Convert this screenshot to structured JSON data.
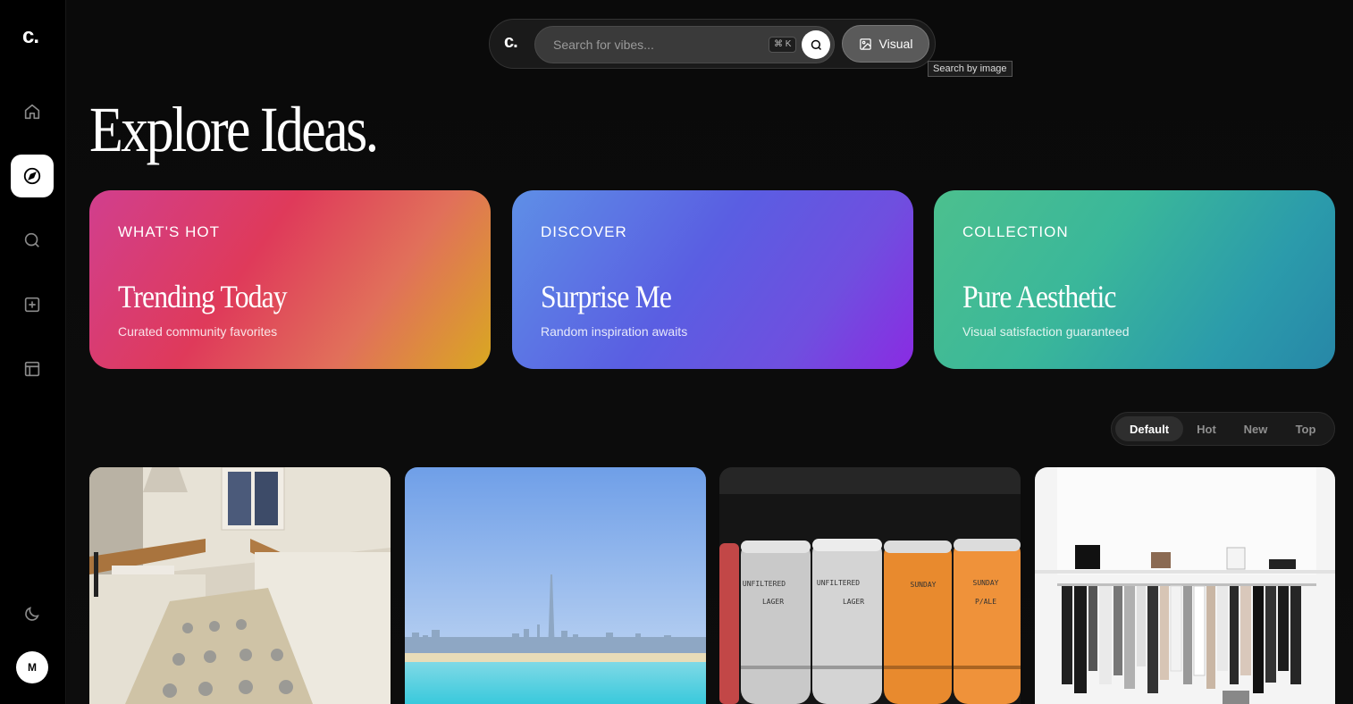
{
  "app": {
    "logo": "c."
  },
  "sidebar": {
    "items": [
      {
        "id": "home",
        "icon": "home-icon"
      },
      {
        "id": "explore",
        "icon": "compass-icon",
        "active": true
      },
      {
        "id": "search",
        "icon": "search-icon"
      },
      {
        "id": "create",
        "icon": "plus-square-icon"
      },
      {
        "id": "boards",
        "icon": "layout-icon"
      }
    ],
    "theme_icon": "moon-icon",
    "avatar_initial": "M"
  },
  "search": {
    "logo": "c.",
    "placeholder": "Search for vibes...",
    "shortcut": "⌘ K",
    "visual_label": "Visual",
    "tooltip": "Search by image"
  },
  "page": {
    "title": "Explore Ideas."
  },
  "cards": [
    {
      "eyebrow": "WHAT'S HOT",
      "title": "Trending Today",
      "subtitle": "Curated community favorites"
    },
    {
      "eyebrow": "DISCOVER",
      "title": "Surprise Me",
      "subtitle": "Random inspiration awaits"
    },
    {
      "eyebrow": "COLLECTION",
      "title": "Pure Aesthetic",
      "subtitle": "Visual satisfaction guaranteed"
    }
  ],
  "sort": {
    "tabs": [
      "Default",
      "Hot",
      "New",
      "Top"
    ],
    "active": "Default"
  },
  "can_labels": {
    "unfiltered": "UNFILTERED",
    "lager": "LAGER",
    "sunday": "SUNDAY",
    "pale": "P/ALE"
  },
  "colors": {
    "accent_hot": "#df3a5a",
    "accent_discover": "#5a5ee2",
    "accent_collection": "#2b9bab"
  }
}
